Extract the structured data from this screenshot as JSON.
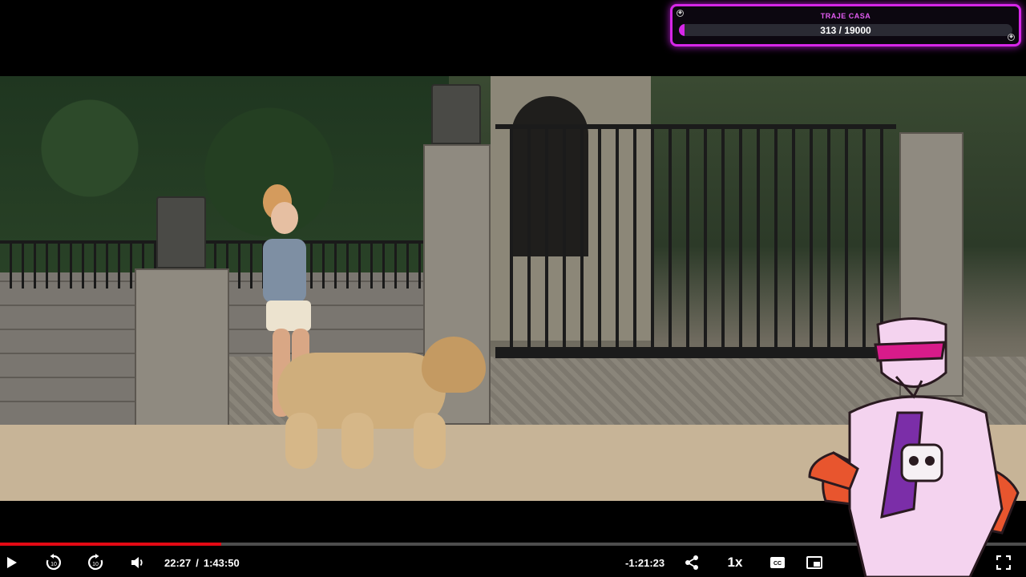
{
  "goal_widget": {
    "title": "TRAJE CASA",
    "current": 313,
    "target": 19000,
    "value_text": "313 / 19000",
    "progress_fraction": 0.0165,
    "accent_color": "#d627e8"
  },
  "player": {
    "progress_fraction": 0.2155,
    "buffered_fraction": 0.2155,
    "current_time": "22:27",
    "separator": "/",
    "duration": "1:43:50",
    "remaining_time": "-1:21:23",
    "speed_label": "1x",
    "skip_back_seconds": "10",
    "skip_forward_seconds": "10",
    "icons": {
      "play": "play-icon",
      "rewind": "rewind-10-icon",
      "forward": "forward-10-icon",
      "volume": "volume-icon",
      "share": "share-icon",
      "captions": "captions-icon",
      "pip": "picture-in-picture-icon",
      "fullscreen": "fullscreen-icon"
    },
    "progress_color": "#e50914"
  }
}
